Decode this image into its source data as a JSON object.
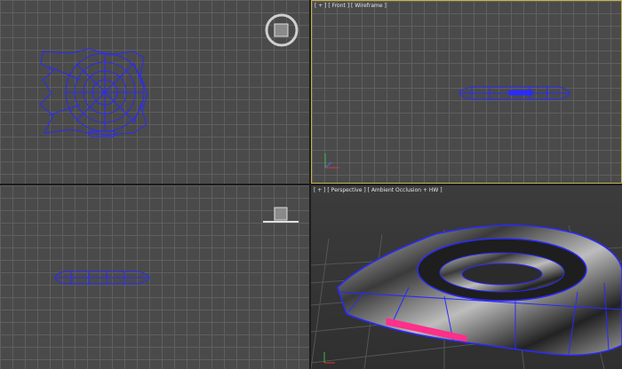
{
  "viewports": {
    "top": {
      "label": ""
    },
    "front": {
      "label": "[ + ] [ Front ] [ Wireframe ]"
    },
    "left": {
      "label": ""
    },
    "perspective": {
      "label": "[ + ] [ Perspective ] [ Ambient Occlusion + HW ]"
    }
  },
  "icons": {
    "viewcube": "viewcube-icon",
    "axis_gizmo": "axis-gizmo-icon"
  },
  "colors": {
    "wireframe": "#2a2aff",
    "active_border": "#c8b24a",
    "highlight": "#ff2f8a",
    "grid_bg": "#4a4a4a"
  }
}
